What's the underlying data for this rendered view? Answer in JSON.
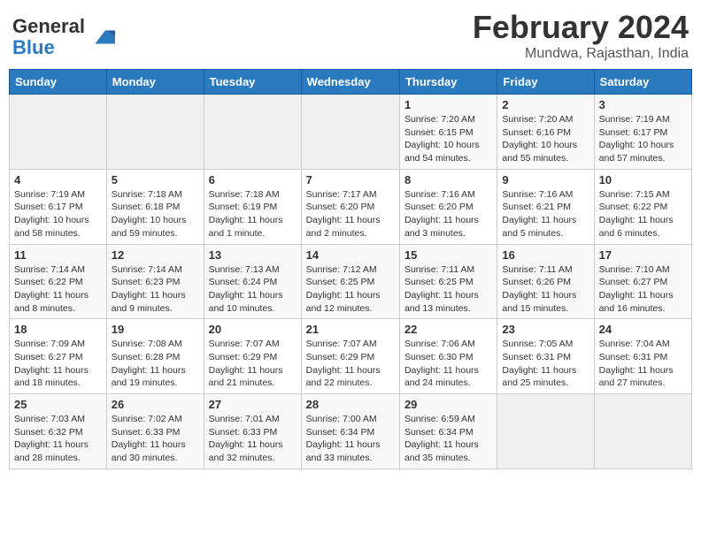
{
  "header": {
    "logo_general": "General",
    "logo_blue": "Blue",
    "month_title": "February 2024",
    "location": "Mundwa, Rajasthan, India"
  },
  "weekdays": [
    "Sunday",
    "Monday",
    "Tuesday",
    "Wednesday",
    "Thursday",
    "Friday",
    "Saturday"
  ],
  "weeks": [
    [
      {
        "day": "",
        "sunrise": "",
        "sunset": "",
        "daylight": ""
      },
      {
        "day": "",
        "sunrise": "",
        "sunset": "",
        "daylight": ""
      },
      {
        "day": "",
        "sunrise": "",
        "sunset": "",
        "daylight": ""
      },
      {
        "day": "",
        "sunrise": "",
        "sunset": "",
        "daylight": ""
      },
      {
        "day": "1",
        "sunrise": "Sunrise: 7:20 AM",
        "sunset": "Sunset: 6:15 PM",
        "daylight": "Daylight: 10 hours and 54 minutes."
      },
      {
        "day": "2",
        "sunrise": "Sunrise: 7:20 AM",
        "sunset": "Sunset: 6:16 PM",
        "daylight": "Daylight: 10 hours and 55 minutes."
      },
      {
        "day": "3",
        "sunrise": "Sunrise: 7:19 AM",
        "sunset": "Sunset: 6:17 PM",
        "daylight": "Daylight: 10 hours and 57 minutes."
      }
    ],
    [
      {
        "day": "4",
        "sunrise": "Sunrise: 7:19 AM",
        "sunset": "Sunset: 6:17 PM",
        "daylight": "Daylight: 10 hours and 58 minutes."
      },
      {
        "day": "5",
        "sunrise": "Sunrise: 7:18 AM",
        "sunset": "Sunset: 6:18 PM",
        "daylight": "Daylight: 10 hours and 59 minutes."
      },
      {
        "day": "6",
        "sunrise": "Sunrise: 7:18 AM",
        "sunset": "Sunset: 6:19 PM",
        "daylight": "Daylight: 11 hours and 1 minute."
      },
      {
        "day": "7",
        "sunrise": "Sunrise: 7:17 AM",
        "sunset": "Sunset: 6:20 PM",
        "daylight": "Daylight: 11 hours and 2 minutes."
      },
      {
        "day": "8",
        "sunrise": "Sunrise: 7:16 AM",
        "sunset": "Sunset: 6:20 PM",
        "daylight": "Daylight: 11 hours and 3 minutes."
      },
      {
        "day": "9",
        "sunrise": "Sunrise: 7:16 AM",
        "sunset": "Sunset: 6:21 PM",
        "daylight": "Daylight: 11 hours and 5 minutes."
      },
      {
        "day": "10",
        "sunrise": "Sunrise: 7:15 AM",
        "sunset": "Sunset: 6:22 PM",
        "daylight": "Daylight: 11 hours and 6 minutes."
      }
    ],
    [
      {
        "day": "11",
        "sunrise": "Sunrise: 7:14 AM",
        "sunset": "Sunset: 6:22 PM",
        "daylight": "Daylight: 11 hours and 8 minutes."
      },
      {
        "day": "12",
        "sunrise": "Sunrise: 7:14 AM",
        "sunset": "Sunset: 6:23 PM",
        "daylight": "Daylight: 11 hours and 9 minutes."
      },
      {
        "day": "13",
        "sunrise": "Sunrise: 7:13 AM",
        "sunset": "Sunset: 6:24 PM",
        "daylight": "Daylight: 11 hours and 10 minutes."
      },
      {
        "day": "14",
        "sunrise": "Sunrise: 7:12 AM",
        "sunset": "Sunset: 6:25 PM",
        "daylight": "Daylight: 11 hours and 12 minutes."
      },
      {
        "day": "15",
        "sunrise": "Sunrise: 7:11 AM",
        "sunset": "Sunset: 6:25 PM",
        "daylight": "Daylight: 11 hours and 13 minutes."
      },
      {
        "day": "16",
        "sunrise": "Sunrise: 7:11 AM",
        "sunset": "Sunset: 6:26 PM",
        "daylight": "Daylight: 11 hours and 15 minutes."
      },
      {
        "day": "17",
        "sunrise": "Sunrise: 7:10 AM",
        "sunset": "Sunset: 6:27 PM",
        "daylight": "Daylight: 11 hours and 16 minutes."
      }
    ],
    [
      {
        "day": "18",
        "sunrise": "Sunrise: 7:09 AM",
        "sunset": "Sunset: 6:27 PM",
        "daylight": "Daylight: 11 hours and 18 minutes."
      },
      {
        "day": "19",
        "sunrise": "Sunrise: 7:08 AM",
        "sunset": "Sunset: 6:28 PM",
        "daylight": "Daylight: 11 hours and 19 minutes."
      },
      {
        "day": "20",
        "sunrise": "Sunrise: 7:07 AM",
        "sunset": "Sunset: 6:29 PM",
        "daylight": "Daylight: 11 hours and 21 minutes."
      },
      {
        "day": "21",
        "sunrise": "Sunrise: 7:07 AM",
        "sunset": "Sunset: 6:29 PM",
        "daylight": "Daylight: 11 hours and 22 minutes."
      },
      {
        "day": "22",
        "sunrise": "Sunrise: 7:06 AM",
        "sunset": "Sunset: 6:30 PM",
        "daylight": "Daylight: 11 hours and 24 minutes."
      },
      {
        "day": "23",
        "sunrise": "Sunrise: 7:05 AM",
        "sunset": "Sunset: 6:31 PM",
        "daylight": "Daylight: 11 hours and 25 minutes."
      },
      {
        "day": "24",
        "sunrise": "Sunrise: 7:04 AM",
        "sunset": "Sunset: 6:31 PM",
        "daylight": "Daylight: 11 hours and 27 minutes."
      }
    ],
    [
      {
        "day": "25",
        "sunrise": "Sunrise: 7:03 AM",
        "sunset": "Sunset: 6:32 PM",
        "daylight": "Daylight: 11 hours and 28 minutes."
      },
      {
        "day": "26",
        "sunrise": "Sunrise: 7:02 AM",
        "sunset": "Sunset: 6:33 PM",
        "daylight": "Daylight: 11 hours and 30 minutes."
      },
      {
        "day": "27",
        "sunrise": "Sunrise: 7:01 AM",
        "sunset": "Sunset: 6:33 PM",
        "daylight": "Daylight: 11 hours and 32 minutes."
      },
      {
        "day": "28",
        "sunrise": "Sunrise: 7:00 AM",
        "sunset": "Sunset: 6:34 PM",
        "daylight": "Daylight: 11 hours and 33 minutes."
      },
      {
        "day": "29",
        "sunrise": "Sunrise: 6:59 AM",
        "sunset": "Sunset: 6:34 PM",
        "daylight": "Daylight: 11 hours and 35 minutes."
      },
      {
        "day": "",
        "sunrise": "",
        "sunset": "",
        "daylight": ""
      },
      {
        "day": "",
        "sunrise": "",
        "sunset": "",
        "daylight": ""
      }
    ]
  ]
}
